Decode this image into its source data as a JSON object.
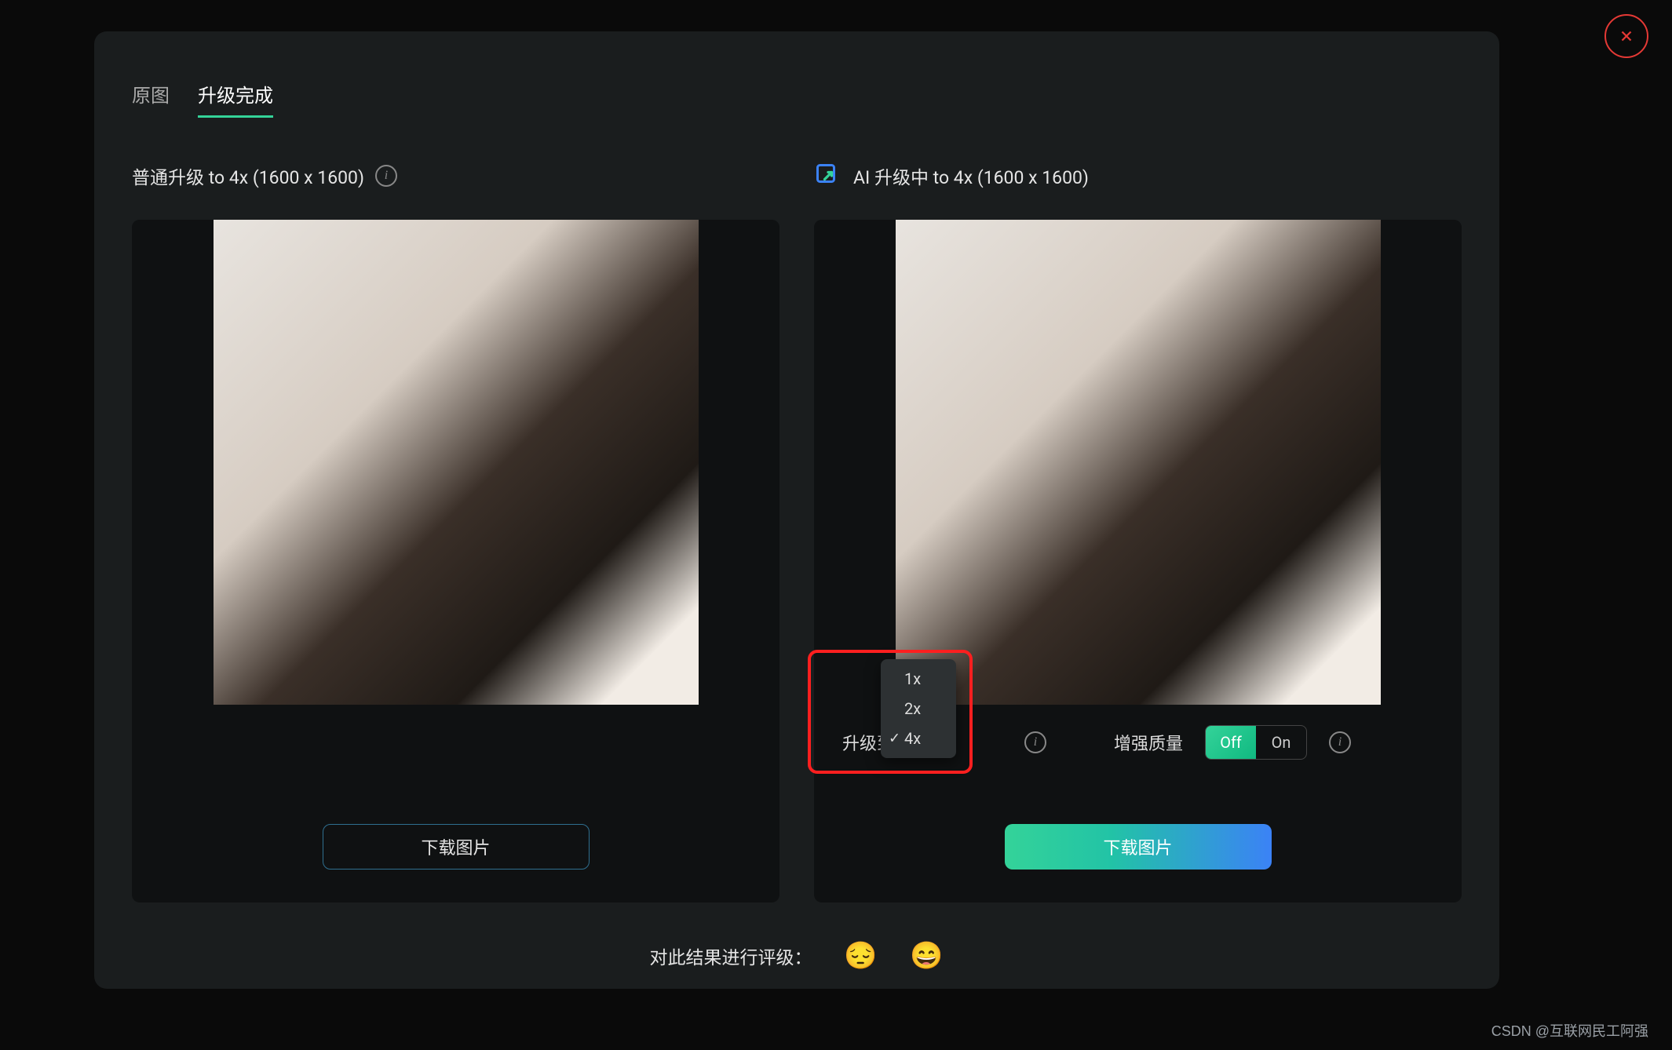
{
  "close_label": "close",
  "tabs": {
    "original": "原图",
    "upgraded": "升级完成",
    "active": 1
  },
  "left": {
    "title": "普通升级 to 4x (1600 x 1600)",
    "download": "下载图片"
  },
  "right": {
    "title": "AI 升级中 to 4x (1600 x 1600)",
    "upscale_label": "升级到",
    "enhance_label": "增强质量",
    "toggle": {
      "off": "Off",
      "on": "On",
      "active": "Off"
    },
    "dropdown": {
      "options": [
        "1x",
        "2x",
        "4x"
      ],
      "selected": "4x"
    },
    "download": "下载图片"
  },
  "rating": {
    "prompt": "对此结果进行评级：",
    "sad": "sad-emoji",
    "happy": "happy-emoji"
  },
  "watermark": "CSDN @互联网民工阿强"
}
